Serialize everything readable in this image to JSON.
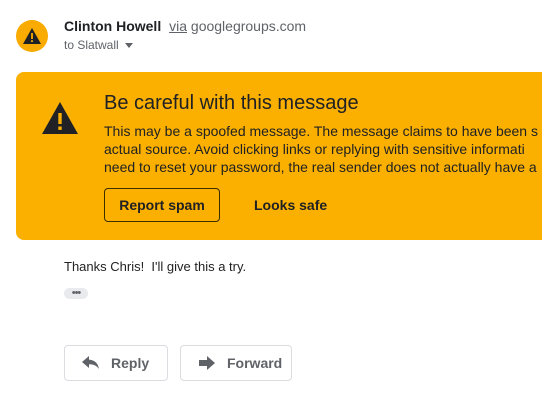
{
  "sender": {
    "name": "Clinton Howell",
    "via_word": "via",
    "via_domain": "googlegroups.com",
    "avatar_icon": "warning-icon",
    "avatar_color": "#f9ab00"
  },
  "recipient": {
    "label": "to Slatwall"
  },
  "warning": {
    "color": "#fbb000",
    "icon": "warning-icon",
    "title": "Be careful with this message",
    "body_lines": [
      "This may be a spoofed message. The message claims to have been s",
      "actual source. Avoid clicking links or replying with sensitive informati",
      "need to reset your password, the real sender does not actually have a"
    ],
    "report_label": "Report spam",
    "safe_label": "Looks safe"
  },
  "message": {
    "text": "Thanks Chris!  I'll give this a try.",
    "ellipsis": "•••"
  },
  "actions": {
    "reply_label": "Reply",
    "reply_icon": "reply-icon",
    "forward_label": "Forward",
    "forward_icon": "forward-icon"
  }
}
